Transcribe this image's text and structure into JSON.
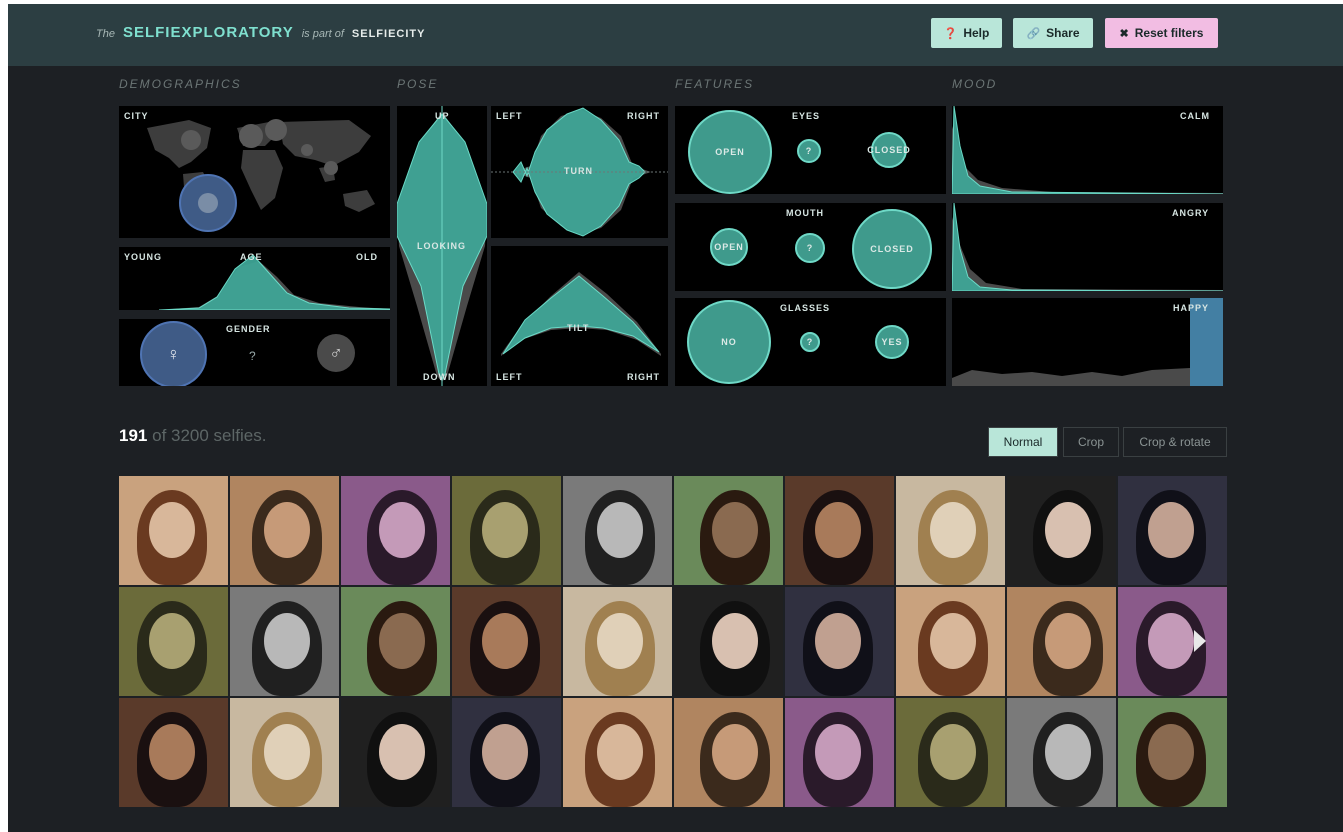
{
  "header": {
    "the": "The",
    "title": "SELFIEXPLORATORY",
    "part_of": "is part of",
    "parent": "SELFIECITY",
    "help": "Help",
    "share": "Share",
    "reset": "Reset filters"
  },
  "sections": {
    "demographics": "DEMOGRAPHICS",
    "pose": "POSE",
    "features": "FEATURES",
    "mood": "MOOD"
  },
  "demographics": {
    "city": "CITY",
    "age": "AGE",
    "young": "YOUNG",
    "old": "OLD",
    "gender": "GENDER",
    "female_icon": "♀",
    "unknown_icon": "?",
    "male_icon": "♂"
  },
  "pose": {
    "up": "UP",
    "looking": "LOOKING",
    "down": "DOWN",
    "left": "LEFT",
    "right": "RIGHT",
    "turn": "TURN",
    "tilt": "TILT"
  },
  "features": {
    "eyes": "EYES",
    "eyes_open": "OPEN",
    "eyes_closed": "CLOSED",
    "mouth": "MOUTH",
    "mouth_open": "OPEN",
    "mouth_closed": "CLOSED",
    "glasses": "GLASSES",
    "glasses_no": "NO",
    "glasses_yes": "YES",
    "unknown": "?"
  },
  "mood": {
    "calm": "CALM",
    "angry": "ANGRY",
    "happy": "HAPPY"
  },
  "results": {
    "count": "191",
    "of_text": "of 3200 selfies.",
    "mode_normal": "Normal",
    "mode_crop": "Crop",
    "mode_crop_rotate": "Crop & rotate"
  },
  "colors": {
    "accent": "#7fe0cf",
    "teal": "#3fa596",
    "reset": "#f2bde3",
    "happy_bar": "#4a8db5"
  }
}
